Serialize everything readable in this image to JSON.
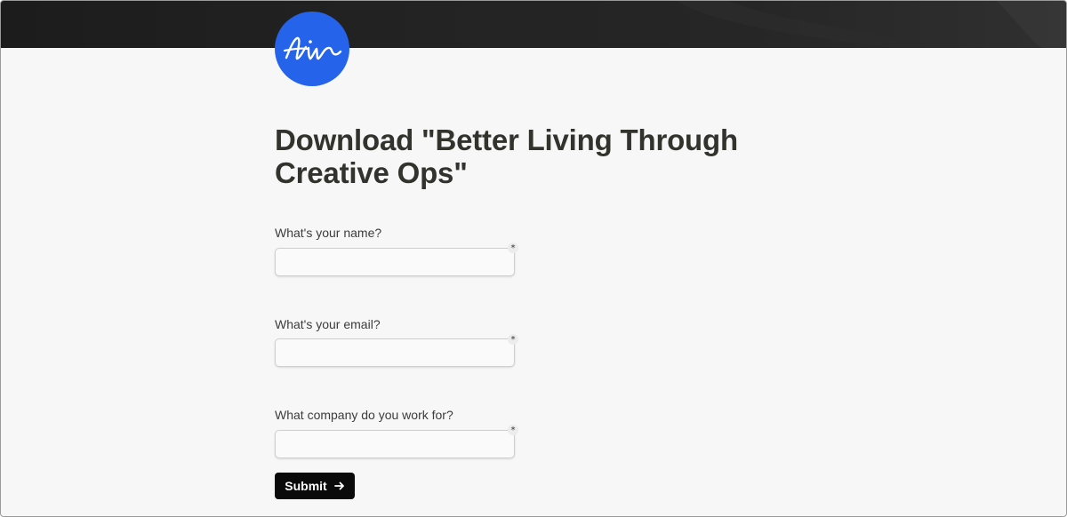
{
  "brand": {
    "logo_text": "Air",
    "logo_color": "#2563eb",
    "cover_color": "#1f1f1f"
  },
  "form": {
    "title": "Download \"Better Living Through Creative Ops\"",
    "fields": [
      {
        "label": "What's your name?",
        "value": "",
        "required": true,
        "required_mark": "*"
      },
      {
        "label": "What's your email?",
        "value": "",
        "required": true,
        "required_mark": "*"
      },
      {
        "label": "What company do you work for?",
        "value": "",
        "required": true,
        "required_mark": "*"
      }
    ],
    "submit_label": "Submit",
    "submit_icon": "arrow-right-icon"
  }
}
